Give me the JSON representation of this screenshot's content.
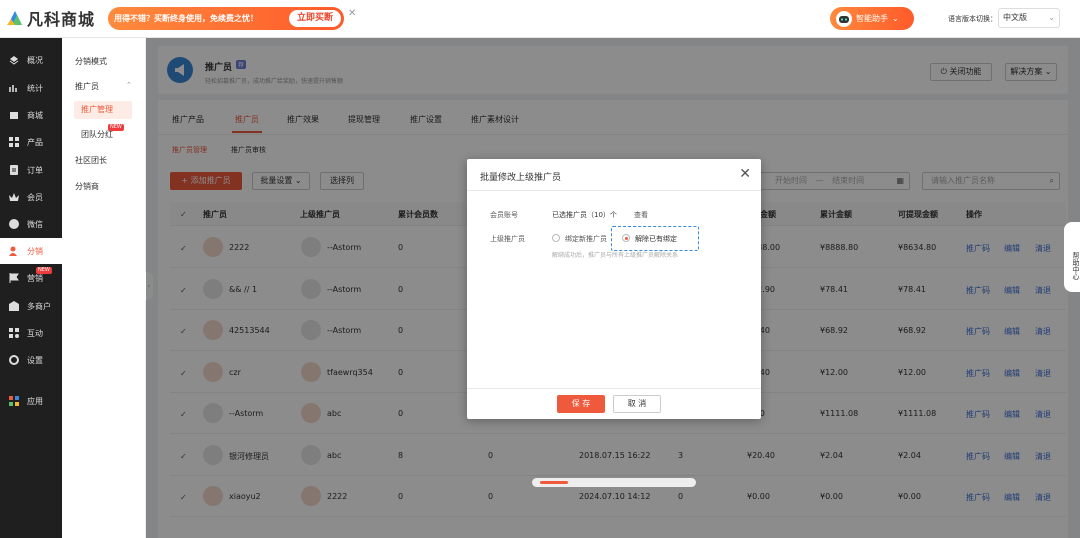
{
  "topbar": {
    "logo_text": "凡科商城",
    "promo_text": "用得不错？买断终身使用，免续费之忧！",
    "promo_button": "立即买断",
    "promo_close": "✕",
    "assistant_label": "智能助手",
    "lang_label": "语言版本切换：",
    "lang_value": "中文版"
  },
  "sidebar_primary": [
    {
      "label": "概况",
      "icon": "dashboard-icon"
    },
    {
      "label": "统计",
      "icon": "chart-icon"
    },
    {
      "label": "商城",
      "icon": "store-icon"
    },
    {
      "label": "产品",
      "icon": "grid-icon"
    },
    {
      "label": "订单",
      "icon": "order-icon"
    },
    {
      "label": "会员",
      "icon": "crown-icon"
    },
    {
      "label": "微信",
      "icon": "wechat-icon"
    },
    {
      "label": "分销",
      "icon": "distribution-icon",
      "active": true
    },
    {
      "label": "营销",
      "icon": "flag-icon",
      "badge": "NEW"
    },
    {
      "label": "多商户",
      "icon": "merchant-icon"
    },
    {
      "label": "互动",
      "icon": "interact-icon"
    },
    {
      "label": "设置",
      "icon": "settings-icon"
    },
    {
      "label": "应用",
      "icon": "apps-icon"
    }
  ],
  "sidebar_secondary": {
    "mode": "分销模式",
    "promoter": "推广员",
    "promoter_manage": "推广管理",
    "team_bonus": "团队分红",
    "team_bonus_badge": "NEW",
    "community": "社区团长",
    "distributor": "分销商"
  },
  "header": {
    "title": "推广员",
    "title_badge": "荐",
    "subtitle": "轻松招募推广员，成功推广给奖励，快速提升销售额",
    "close_button": "关闭功能",
    "solution_button": "解决方案"
  },
  "tabs": [
    "推广产品",
    "推广员",
    "推广效果",
    "提现管理",
    "推广设置",
    "推广素材设计"
  ],
  "subtabs": [
    "推广员管理",
    "推广员审核"
  ],
  "toolbar": {
    "add_button": "+ 添加推广员",
    "batch_button": "批量设置",
    "select_col_button": "选择列",
    "date_start": "开始时间",
    "date_end": "结束时间",
    "date_sep": "—",
    "search_placeholder": "请输入推广员名称"
  },
  "table": {
    "headers": [
      "推广员",
      "上级推广员",
      "累计会员数",
      "金额",
      "累计金额",
      "可提现金额",
      "操作"
    ],
    "rows": [
      {
        "name": "2222",
        "parent": "--Astorm",
        "members": "0",
        "c4": "",
        "c5": "",
        "c6": "",
        "amount": "8888.00",
        "total": "¥8888.80",
        "withdrawable": "¥8634.80"
      },
      {
        "name": "&& // 1",
        "parent": "--Astorm",
        "members": "0",
        "c4": "",
        "c5": "",
        "c6": "",
        "amount": "202.90",
        "total": "¥78.41",
        "withdrawable": "¥78.41"
      },
      {
        "name": "42513544",
        "parent": "--Astorm",
        "members": "0",
        "c4": "",
        "c5": "",
        "c6": "",
        "amount": "68.40",
        "total": "¥68.92",
        "withdrawable": "¥68.92"
      },
      {
        "name": "czr",
        "parent": "tfaewrq354",
        "members": "0",
        "c4": "",
        "c5": "",
        "c6": "",
        "amount": "79.40",
        "total": "¥12.00",
        "withdrawable": "¥12.00"
      },
      {
        "name": "--Astorm",
        "parent": "abc",
        "members": "0",
        "c4": "",
        "c5": "",
        "c6": "",
        "amount": "1.00",
        "total": "¥1111.08",
        "withdrawable": "¥1111.08"
      },
      {
        "name": "银河修理员",
        "parent": "abc",
        "members": "8",
        "c4": "0",
        "c5": "2018.07.15 16:22",
        "c6": "3",
        "amount": "¥20.40",
        "total": "¥2.04",
        "withdrawable": "¥2.04"
      },
      {
        "name": "xiaoyu2",
        "parent": "2222",
        "members": "0",
        "c4": "0",
        "c5": "2024.07.10 14:12",
        "c6": "0",
        "amount": "¥0.00",
        "total": "¥0.00",
        "withdrawable": "¥0.00"
      }
    ],
    "actions": [
      "推广码",
      "编辑",
      "清退"
    ]
  },
  "modal": {
    "title": "批量修改上级推广员",
    "member_label": "会员账号",
    "member_value": "已选推广员（10）个",
    "member_link": "查看",
    "parent_label": "上级推广员",
    "option_bind": "绑定新推广员",
    "option_unbind": "解除已有绑定",
    "hint": "解绑成功后，推广员与所有上级推广员解除关系",
    "save": "保 存",
    "cancel": "取 消"
  },
  "help_tab": "帮助中心",
  "colors": {
    "accent": "#ee5a3b",
    "link": "#3a6fd8",
    "sidebar": "#1f1f1f"
  }
}
